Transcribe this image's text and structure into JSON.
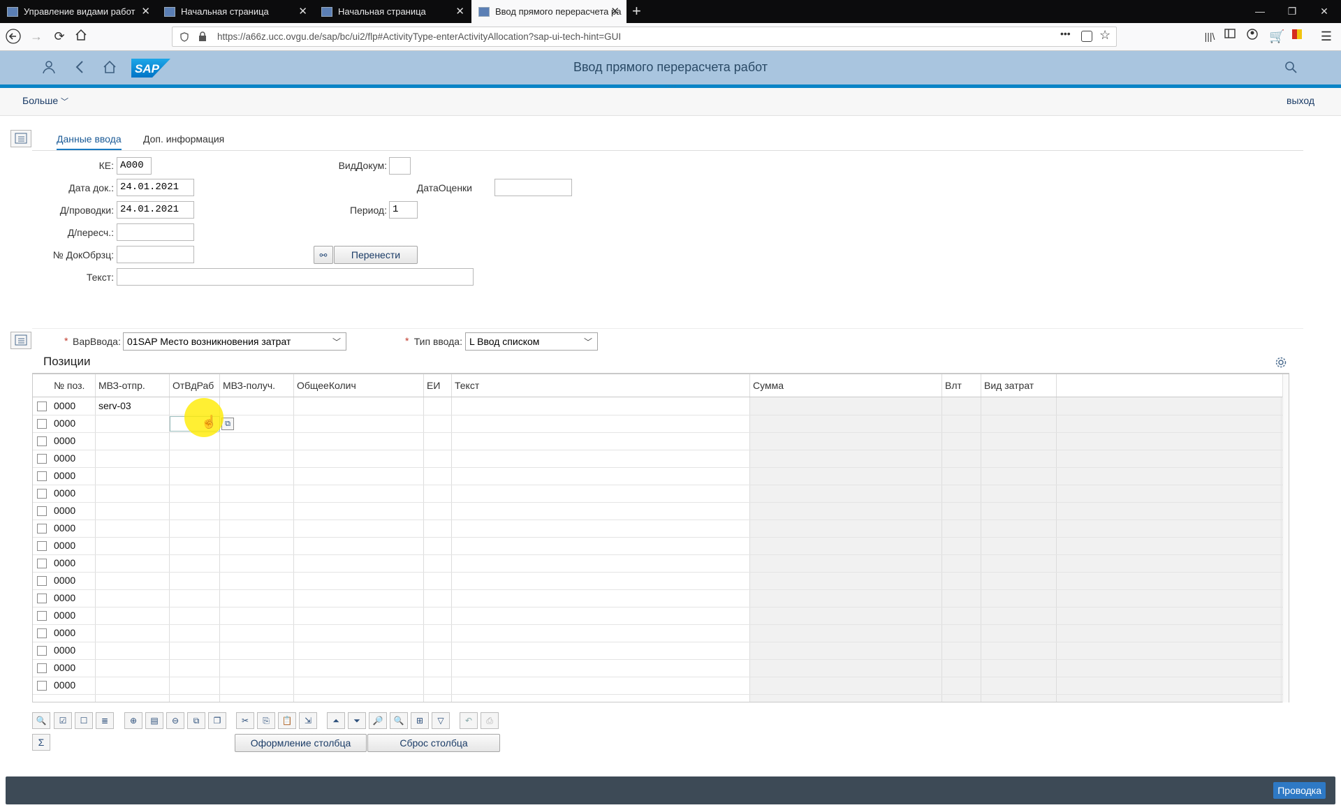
{
  "browser": {
    "tabs": [
      {
        "title": "Управление видами работ"
      },
      {
        "title": "Начальная страница"
      },
      {
        "title": "Начальная страница"
      },
      {
        "title": "Ввод прямого перерасчета ра"
      }
    ],
    "url": "https://a66z.ucc.ovgu.de/sap/bc/ui2/flp#ActivityType-enterActivityAllocation?sap-ui-tech-hint=GUI",
    "url_dots": "•••"
  },
  "shell": {
    "title": "Ввод прямого перерасчета работ",
    "logo_text": "SAP"
  },
  "toolbar": {
    "more_label": "Больше",
    "exit_label": "выход"
  },
  "tabs": [
    {
      "label": "Данные ввода"
    },
    {
      "label": "Доп. информация"
    }
  ],
  "form": {
    "ke_label": "КЕ:",
    "ke_value": "A000",
    "docdate_label": "Дата док.:",
    "docdate_value": "24.01.2021",
    "postdate_label": "Д/проводки:",
    "postdate_value": "24.01.2021",
    "recalc_label": "Д/пересч.:",
    "recalc_value": "",
    "refdoc_label": "№ ДокОбрзц:",
    "refdoc_value": "",
    "text_label": "Текст:",
    "text_value": "",
    "doctype_label": "ВидДокум:",
    "doctype_value": "",
    "valdate_label": "ДатаОценки",
    "valdate_value": "",
    "period_label": "Период:",
    "period_value": "1",
    "transfer_label": "Перенести"
  },
  "entry": {
    "variant_label": "ВарВвода:",
    "variant_value": "01SAP Место возникновения затрат",
    "type_label": "Тип ввода:",
    "type_value": "L Ввод списком",
    "required_mark": "*"
  },
  "positions": {
    "title": "Позиции",
    "columns": [
      "№ поз.",
      "МВЗ-отпр.",
      "ОтВдРаб",
      "МВЗ-получ.",
      "ОбщееКолич",
      "ЕИ",
      "Текст",
      "Сумма",
      "Влт",
      "Вид затрат"
    ],
    "rows": [
      {
        "pos": "0000",
        "sender": "serv-03"
      },
      {
        "pos": "0000",
        "sender": ""
      },
      {
        "pos": "0000",
        "sender": ""
      },
      {
        "pos": "0000",
        "sender": ""
      },
      {
        "pos": "0000",
        "sender": ""
      },
      {
        "pos": "0000",
        "sender": ""
      },
      {
        "pos": "0000",
        "sender": ""
      },
      {
        "pos": "0000",
        "sender": ""
      },
      {
        "pos": "0000",
        "sender": ""
      },
      {
        "pos": "0000",
        "sender": ""
      },
      {
        "pos": "0000",
        "sender": ""
      },
      {
        "pos": "0000",
        "sender": ""
      },
      {
        "pos": "0000",
        "sender": ""
      },
      {
        "pos": "0000",
        "sender": ""
      },
      {
        "pos": "0000",
        "sender": ""
      },
      {
        "pos": "0000",
        "sender": ""
      },
      {
        "pos": "0000",
        "sender": ""
      }
    ]
  },
  "bottom": {
    "column_layout_label": "Оформление столбца",
    "column_reset_label": "Сброс столбца",
    "sum_symbol": "Σ"
  },
  "footer": {
    "post_label": "Проводка"
  },
  "colors": {
    "shell": "#a9c5df",
    "accent": "#0a84c6",
    "footer": "#3d4a56",
    "post_button": "#2e79c5"
  }
}
